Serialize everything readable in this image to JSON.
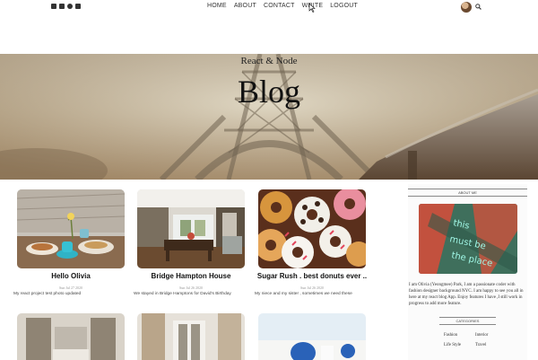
{
  "topbar": {
    "social_icons": [
      "facebook-icon",
      "twitter-icon",
      "pinterest-icon",
      "instagram-icon"
    ],
    "nav": [
      "HOME",
      "ABOUT",
      "CONTACT",
      "WRITE",
      "LOGOUT"
    ]
  },
  "header": {
    "small_title": "React & Node",
    "large_title": "Blog"
  },
  "posts": [
    {
      "title": "Hello Olivia",
      "date": "Sun Jul 27 2020",
      "desc": "My react project test photo updated"
    },
    {
      "title": "Bridge Hampton House",
      "date": "Sun Jul 26 2020",
      "desc": "We stayed in Bridge Hamptons for David's Birthday"
    },
    {
      "title": "Sugar Rush . best donuts ever ..",
      "date": "Sun Jul 26 2020",
      "desc": "My niece and my sister , sometimes we need these"
    }
  ],
  "sidebar": {
    "about_title": "ABOUT ME",
    "about_image_text": "this must be the place",
    "about_text": "I am Olivia (Yeongmee) Park, I am a passionate coder with fashion designer background NYC. I am happy to see you all in here at my react blog App. Enjoy features I have ,I still work in progress to add more feature.",
    "categories_title": "CATEGORIES",
    "categories": [
      "Fashion",
      "Interior",
      "Life Style",
      "Travel"
    ]
  },
  "colors": {
    "accent_text": "#111111",
    "neon_sign": "#36d6b0"
  }
}
